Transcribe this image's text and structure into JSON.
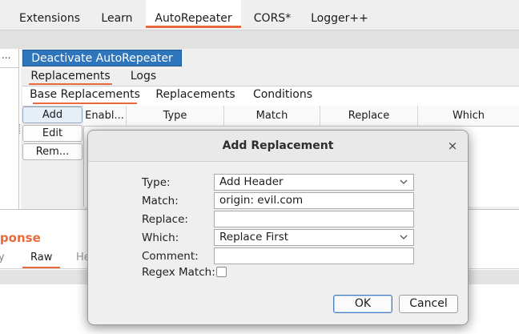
{
  "top_tabs": [
    {
      "label": "Extensions"
    },
    {
      "label": "Learn"
    },
    {
      "label": "AutoRepeater"
    },
    {
      "label": "CORS*"
    },
    {
      "label": "Logger++"
    }
  ],
  "left_panel": {
    "menu": "..."
  },
  "autorepeater": {
    "deactivate_label": "Deactivate AutoRepeater",
    "panel_tabs": [
      {
        "label": "Replacements"
      },
      {
        "label": "Logs"
      }
    ],
    "sub_tabs": [
      {
        "label": "Base Replacements"
      },
      {
        "label": "Replacements"
      },
      {
        "label": "Conditions"
      }
    ],
    "buttons": {
      "add": "Add",
      "edit": "Edit",
      "remove": "Rem..."
    },
    "table": {
      "columns": [
        "Enabl...",
        "Type",
        "Match",
        "Replace",
        "Which"
      ]
    }
  },
  "response": {
    "title": "sponse",
    "tabs": [
      {
        "label": "y"
      },
      {
        "label": "Raw"
      },
      {
        "label": "He"
      }
    ]
  },
  "dialog": {
    "title": "Add Replacement",
    "close_glyph": "×",
    "fields": {
      "type": {
        "label": "Type:",
        "value": "Add Header"
      },
      "match": {
        "label": "Match:",
        "value": "origin: evil.com"
      },
      "replace": {
        "label": "Replace:",
        "value": ""
      },
      "which": {
        "label": "Which:",
        "value": "Replace First"
      },
      "comment": {
        "label": "Comment:",
        "value": ""
      },
      "regex": {
        "label": "Regex Match:",
        "checked": false
      }
    },
    "ok_label": "OK",
    "cancel_label": "Cancel"
  },
  "colors": {
    "accent": "#e8693c",
    "primary_button": "#2f75bb"
  }
}
